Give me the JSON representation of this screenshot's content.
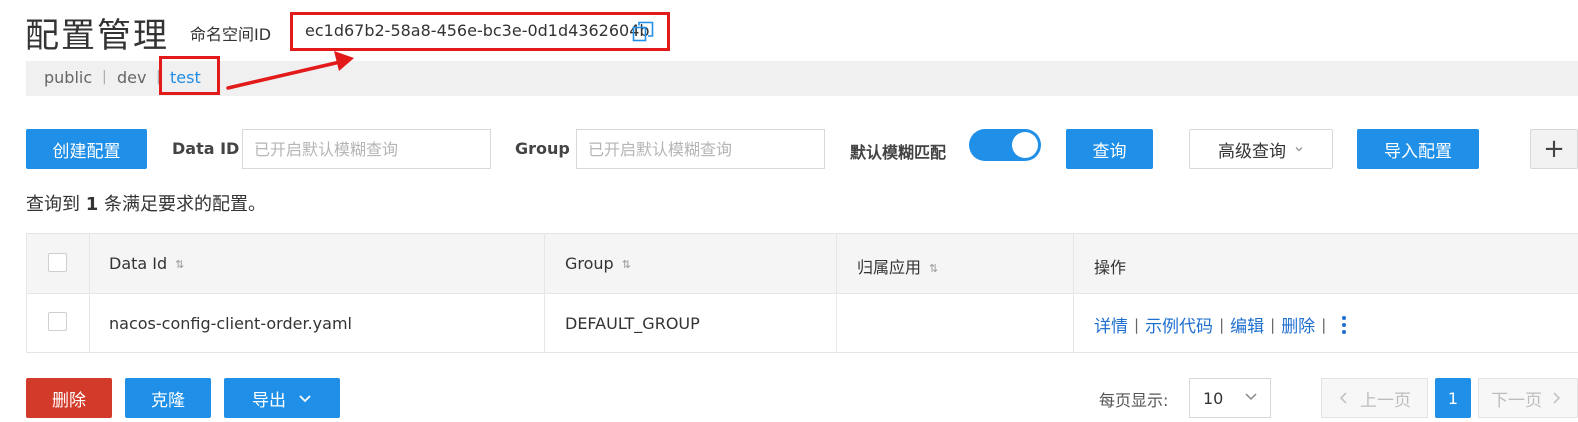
{
  "header": {
    "title": "配置管理",
    "namespace_label": "命名空间ID",
    "namespace_id": "ec1d67b2-58a8-456e-bc3e-0d1d4362604b"
  },
  "namespaces": {
    "tabs": [
      "public",
      "dev",
      "test"
    ],
    "active": "test",
    "separator": "|"
  },
  "toolbar": {
    "create_label": "创建配置",
    "data_id_label": "Data ID",
    "data_id_placeholder": "已开启默认模糊查询",
    "group_label": "Group",
    "group_placeholder": "已开启默认模糊查询",
    "fuzzy_label": "默认模糊匹配",
    "fuzzy_enabled": true,
    "search_label": "查询",
    "advanced_label": "高级查询",
    "import_label": "导入配置",
    "add_symbol": "+"
  },
  "result": {
    "prefix": "查询到",
    "count": "1",
    "suffix": "条满足要求的配置。"
  },
  "table": {
    "columns": [
      "Data Id",
      "Group",
      "归属应用",
      "操作"
    ],
    "rows": [
      {
        "data_id": "nacos-config-client-order.yaml",
        "group": "DEFAULT_GROUP",
        "app": "",
        "actions": [
          "详情",
          "示例代码",
          "编辑",
          "删除"
        ]
      }
    ]
  },
  "footer": {
    "delete_label": "删除",
    "clone_label": "克隆",
    "export_label": "导出",
    "per_page_label": "每页显示:",
    "per_page_value": "10",
    "prev_label": "上一页",
    "current_page": "1",
    "next_label": "下一页"
  },
  "colors": {
    "primary": "#1f8fe8",
    "danger": "#d23b2a",
    "annotation_red": "#e21a1a",
    "link": "#1f6fd1"
  }
}
